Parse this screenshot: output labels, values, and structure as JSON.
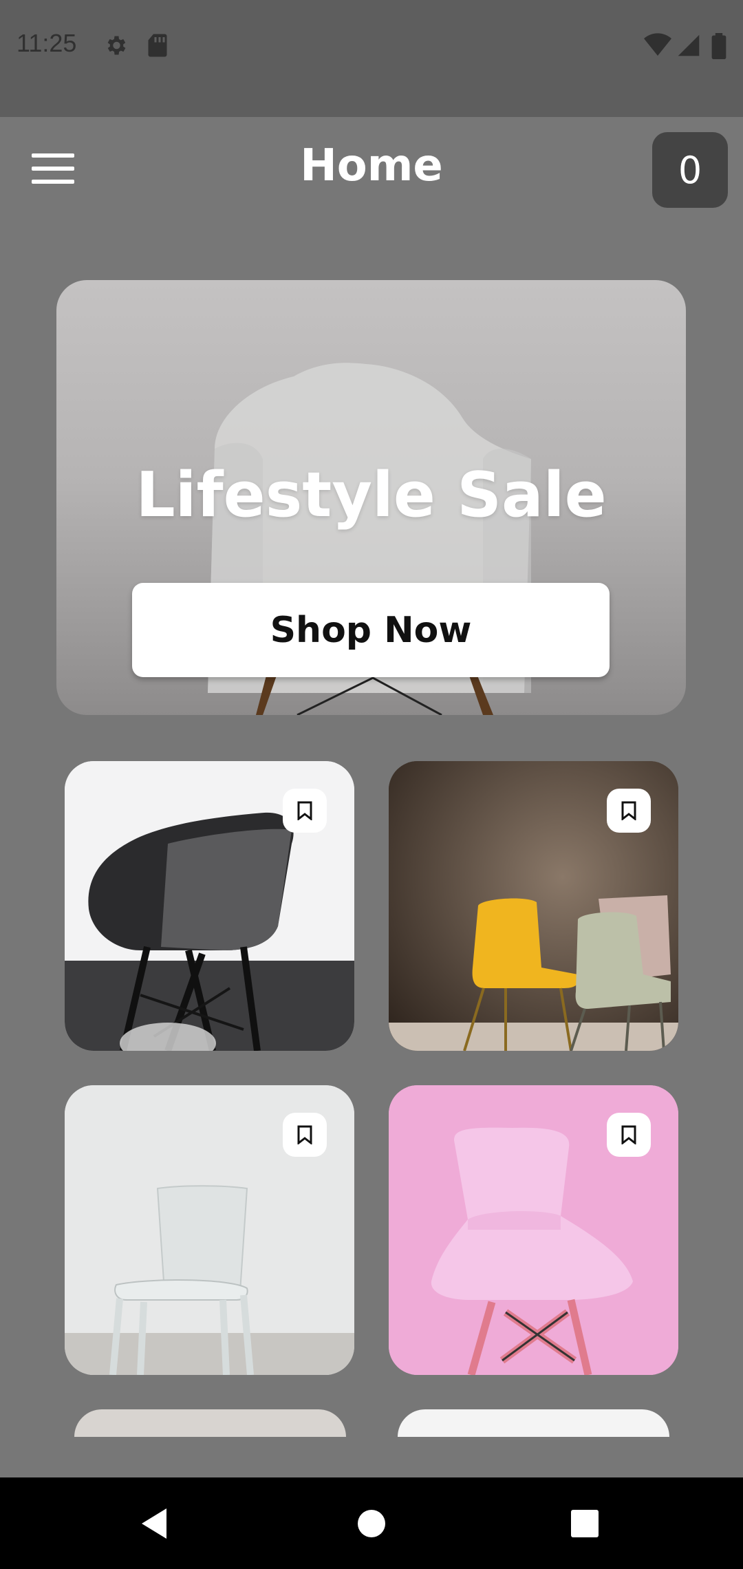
{
  "status_bar": {
    "time": "11:25",
    "left_icons": [
      "settings-icon",
      "sd-card-icon"
    ],
    "right_icons": [
      "wifi-icon",
      "cell-signal-icon",
      "battery-icon"
    ]
  },
  "app_bar": {
    "title": "Home",
    "cart_count": "0",
    "menu_icon": "menu-icon"
  },
  "hero": {
    "title": "Lifestyle Sale",
    "button_label": "Shop Now"
  },
  "products": [
    {
      "name": "black-armchair",
      "bookmark_icon": "bookmark-icon"
    },
    {
      "name": "yellow-and-sage-chairs",
      "bookmark_icon": "bookmark-icon"
    },
    {
      "name": "white-chair",
      "bookmark_icon": "bookmark-icon"
    },
    {
      "name": "pink-chair",
      "bookmark_icon": "bookmark-icon"
    }
  ],
  "nav_bar": {
    "icons": [
      "back-icon",
      "home-icon",
      "recents-icon"
    ]
  },
  "colors": {
    "background": "#777777",
    "status_bar": "#5e5e5e",
    "cart_badge": "#444444",
    "nav_bar": "#000000"
  }
}
